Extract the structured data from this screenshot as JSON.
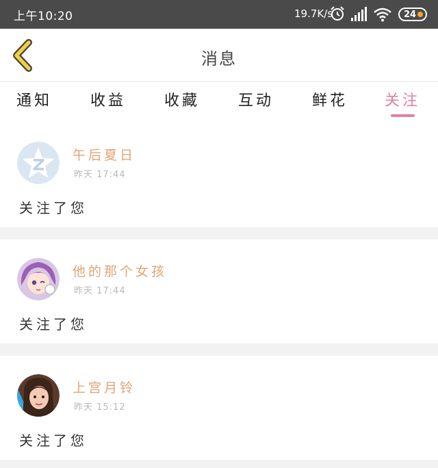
{
  "status_bar": {
    "time": "上午10:20",
    "network_speed": "19.7K/s",
    "battery": "24",
    "icons": [
      "alarm-icon",
      "signal-icon",
      "wifi-icon",
      "battery-icon"
    ]
  },
  "header": {
    "title": "消息",
    "back_icon": "chevron-left-icon"
  },
  "tabs": [
    {
      "label": "通知",
      "active": false
    },
    {
      "label": "收益",
      "active": false
    },
    {
      "label": "收藏",
      "active": false
    },
    {
      "label": "互动",
      "active": false
    },
    {
      "label": "鲜花",
      "active": false
    },
    {
      "label": "关注",
      "active": true
    }
  ],
  "messages": [
    {
      "username": "午后夏日",
      "time": "昨天 17:44",
      "text": "关注了您"
    },
    {
      "username": "他的那个女孩",
      "time": "昨天 17:44",
      "text": "关注了您"
    },
    {
      "username": "上宫月铃",
      "time": "昨天 15:12",
      "text": "关注了您"
    }
  ],
  "colors": {
    "accent": "#e37fa2",
    "username": "#e2a374",
    "back_arrow": "#f4cf3c",
    "status_bar_bg": "#4a4a4a"
  }
}
